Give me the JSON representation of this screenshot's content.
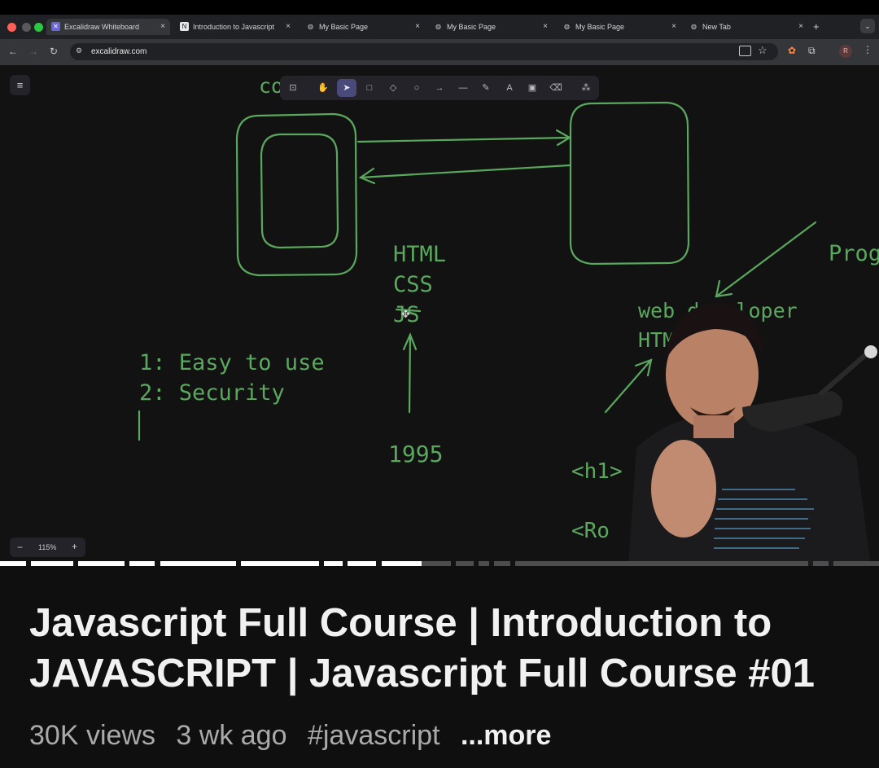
{
  "browser": {
    "tabs": [
      {
        "label": "Excalidraw Whiteboard",
        "icon": "excalidraw-icon",
        "active": true
      },
      {
        "label": "Introduction to Javascript",
        "icon": "notion-icon",
        "active": false
      },
      {
        "label": "My Basic Page",
        "icon": "globe-icon",
        "active": false
      },
      {
        "label": "My Basic Page",
        "icon": "globe-icon",
        "active": false
      },
      {
        "label": "My Basic Page",
        "icon": "globe-icon",
        "active": false
      },
      {
        "label": "New Tab",
        "icon": "globe-icon",
        "active": false
      }
    ],
    "close_glyph": "×",
    "new_tab_glyph": "+",
    "url": "excalidraw.com",
    "profile_initial": "R"
  },
  "excalidraw": {
    "zoom_label": "115%",
    "zoom_out": "−",
    "zoom_in": "+",
    "menu_glyph": "≡",
    "tools": [
      "lock-icon",
      "hand-icon",
      "selection-icon",
      "rectangle-icon",
      "diamond-icon",
      "ellipse-icon",
      "arrow-icon",
      "line-icon",
      "pencil-icon",
      "text-icon",
      "image-icon",
      "eraser-icon",
      "extra-tools-icon"
    ],
    "active_tool": "selection-icon"
  },
  "drawing": {
    "partial_top": "co",
    "tech_list": [
      "HTML",
      "CSS",
      "JS"
    ],
    "year": "1995",
    "reasons": [
      "1: Easy to use",
      "2: Security"
    ],
    "partial_right": "Prog",
    "web_dev_line1": "web developer",
    "web_dev_line2": "HTML CSS",
    "tag_h1": "<h1>",
    "tag_ro": "<Ro"
  },
  "video": {
    "title": "Javascript Full Course | Introduction to JAVASCRIPT | Javascript Full Course #01",
    "views": "30K views",
    "age": "3 wk ago",
    "hashtag": "#javascript",
    "more": "...more",
    "progress_fraction": 0.48
  },
  "colors": {
    "ink": "#5aa85e",
    "canvas": "#121212",
    "progress_played": "#ffffff",
    "progress_buffered": "#888888"
  }
}
